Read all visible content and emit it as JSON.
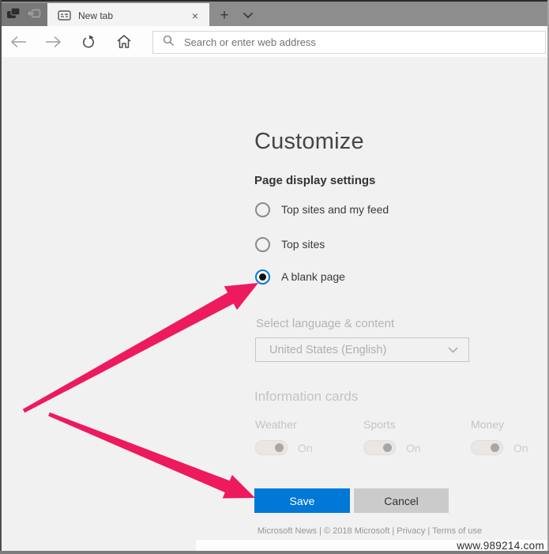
{
  "icons": {
    "close_glyph": "×",
    "plus_glyph": "+"
  },
  "tabbar": {
    "tab_title": "New tab"
  },
  "navbar": {
    "search_placeholder": "Search or enter web address"
  },
  "content": {
    "title": "Customize",
    "display": {
      "heading": "Page display settings",
      "options": [
        {
          "label": "Top sites and my feed",
          "selected": false
        },
        {
          "label": "Top sites",
          "selected": false
        },
        {
          "label": "A blank page",
          "selected": true
        }
      ]
    },
    "language": {
      "label": "Select language & content",
      "value": "United States (English)",
      "enabled": false
    },
    "cards": {
      "heading": "Information cards",
      "enabled": false,
      "items": [
        {
          "label": "Weather",
          "state": "On"
        },
        {
          "label": "Sports",
          "state": "On"
        },
        {
          "label": "Money",
          "state": "On"
        }
      ]
    },
    "actions": {
      "save": "Save",
      "cancel": "Cancel"
    },
    "footer": "Microsoft News | © 2018 Microsoft | Privacy | Terms of use"
  },
  "watermark": "www.989214.com",
  "colors": {
    "save_button_blue": "#0078d7",
    "annotation_arrow_pink": "#ed1a5e",
    "radio_selected_ring": "#0078d7",
    "tabbar_gray": "#8d8d8d"
  }
}
